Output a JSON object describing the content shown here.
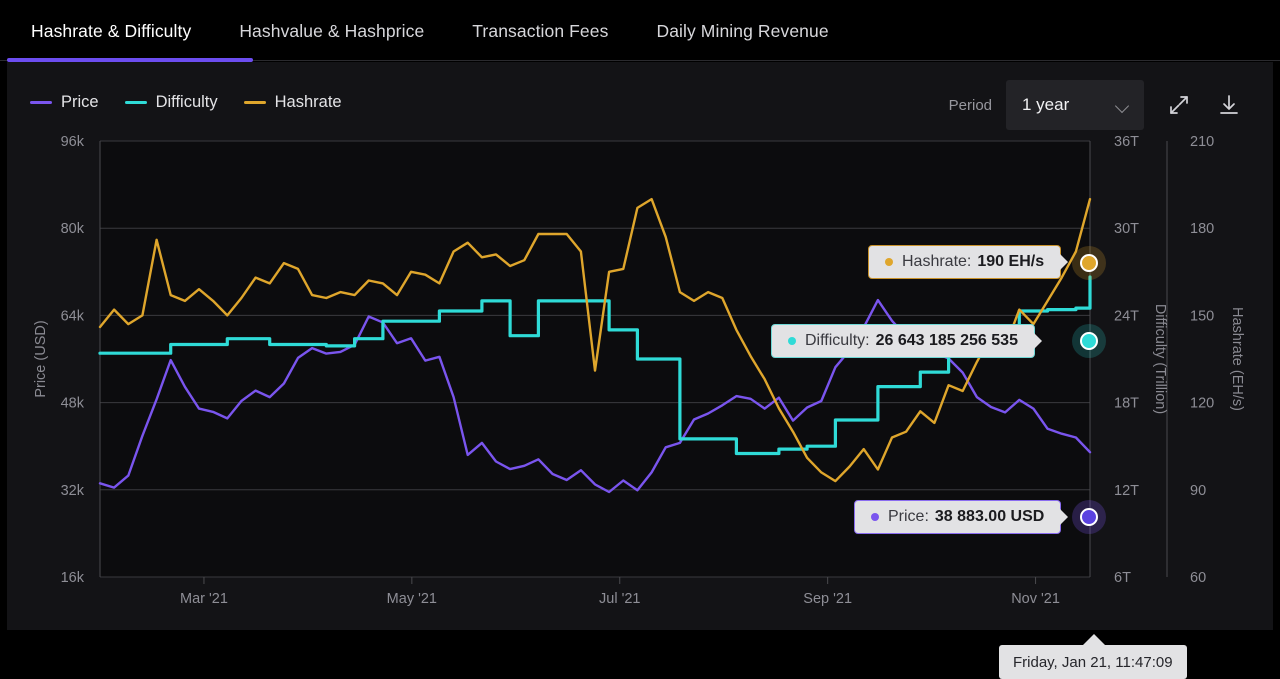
{
  "tabs": [
    {
      "label": "Hashrate & Difficulty",
      "active": true
    },
    {
      "label": "Hashvalue & Hashprice",
      "active": false
    },
    {
      "label": "Transaction Fees",
      "active": false
    },
    {
      "label": "Daily Mining Revenue",
      "active": false
    }
  ],
  "toolbar": {
    "period_label": "Period",
    "period_value": "1 year",
    "chevron_icon": "chevron-down-icon",
    "expand_icon": "expand-fullscreen-icon",
    "download_icon": "download-icon"
  },
  "legend": [
    {
      "label": "Price",
      "color": "#7a55ee"
    },
    {
      "label": "Difficulty",
      "color": "#2fdbd7"
    },
    {
      "label": "Hashrate",
      "color": "#dfa62c"
    }
  ],
  "tooltips": {
    "hashrate": {
      "name": "Hashrate:",
      "value": "190 EH/s",
      "color": "#dfa62c",
      "border": "#c9922a"
    },
    "difficulty": {
      "name": "Difficulty:",
      "value": "26 643 185 256 535",
      "color": "#2fdbd7",
      "border": "#6fd8d6"
    },
    "price": {
      "name": "Price:",
      "value": "38 883.00 USD",
      "color": "#7a55ee",
      "border": "#8a6cf0"
    },
    "date": {
      "value": "Friday, Jan 21, 11:47:09"
    }
  },
  "chart_data": {
    "type": "line",
    "title": "Hashrate & Difficulty",
    "xlabel": "",
    "grid": true,
    "legend_position": "top-left",
    "x_tick_labels": [
      "Mar '21",
      "May '21",
      "Jul '21",
      "Sep '21",
      "Nov '21"
    ],
    "x_tick_positions": [
      0.105,
      0.315,
      0.525,
      0.735,
      0.945
    ],
    "axes": [
      {
        "id": "price",
        "title": "Price (USD)",
        "side": "left",
        "ticks": [
          "96k",
          "80k",
          "64k",
          "48k",
          "32k",
          "16k"
        ],
        "tick_values": [
          96000,
          80000,
          64000,
          48000,
          32000,
          16000
        ],
        "ylim": [
          16000,
          96000
        ]
      },
      {
        "id": "difficulty",
        "title": "Difficulty (Trillion)",
        "side": "right",
        "ticks": [
          "36T",
          "30T",
          "24T",
          "18T",
          "12T",
          "6T"
        ],
        "tick_values": [
          36,
          30,
          24,
          18,
          12,
          6
        ],
        "ylim": [
          6,
          36
        ]
      },
      {
        "id": "hashrate",
        "title": "Hashrate (EH/s)",
        "side": "right",
        "ticks": [
          "210",
          "180",
          "150",
          "120",
          "90",
          "60"
        ],
        "tick_values": [
          210,
          180,
          150,
          120,
          90,
          60
        ],
        "ylim": [
          60,
          210
        ]
      }
    ],
    "series": [
      {
        "name": "Price",
        "color": "#7a55ee",
        "axis": "price",
        "unit": "USD",
        "last_value": 38883,
        "values": [
          33200,
          32400,
          34600,
          41900,
          48600,
          55800,
          50900,
          46900,
          46300,
          45100,
          48300,
          50200,
          49000,
          51500,
          56200,
          58000,
          57000,
          57300,
          58600,
          63800,
          62700,
          58900,
          59800,
          55700,
          56400,
          49000,
          38400,
          40600,
          37200,
          35800,
          36400,
          37600,
          34900,
          33800,
          35600,
          33000,
          31600,
          33700,
          31900,
          35200,
          39800,
          40600,
          44900,
          46000,
          47500,
          49200,
          48700,
          46900,
          48900,
          44700,
          47100,
          48300,
          54500,
          57600,
          61800,
          66800,
          63000,
          60200,
          58800,
          57200,
          56100,
          53500,
          49000,
          47200,
          46200,
          48500,
          46900,
          43200,
          42300,
          41600,
          38900
        ]
      },
      {
        "name": "Difficulty",
        "color": "#2fdbd7",
        "axis": "difficulty",
        "unit": "Trillion",
        "last_value": 26.64,
        "last_value_raw": "26 643 185 256 535",
        "values": [
          21.4,
          21.4,
          21.4,
          21.4,
          21.4,
          22.0,
          22.0,
          22.0,
          22.0,
          22.4,
          22.4,
          22.4,
          22.0,
          22.0,
          22.0,
          22.0,
          21.9,
          21.9,
          22.4,
          22.4,
          23.6,
          23.6,
          23.6,
          23.6,
          24.3,
          24.3,
          24.3,
          25.0,
          25.0,
          22.6,
          22.6,
          25.0,
          25.0,
          25.0,
          25.0,
          25.0,
          23.0,
          23.0,
          21.0,
          21.0,
          21.0,
          15.5,
          15.5,
          15.5,
          15.5,
          14.5,
          14.5,
          14.5,
          14.8,
          14.8,
          15.0,
          15.0,
          16.8,
          16.8,
          16.8,
          19.1,
          19.1,
          19.1,
          20.1,
          20.1,
          21.7,
          21.7,
          21.7,
          22.3,
          22.3,
          24.3,
          24.3,
          24.4,
          24.4,
          24.5,
          26.64
        ]
      },
      {
        "name": "Hashrate",
        "color": "#dfa62c",
        "axis": "hashrate",
        "unit": "EH/s",
        "last_value": 190,
        "values": [
          146,
          152,
          147,
          150,
          176,
          157,
          155,
          159,
          155,
          150,
          156,
          163,
          161,
          168,
          166,
          157,
          156,
          158,
          157,
          162,
          161,
          157,
          165,
          164,
          161,
          172,
          175,
          170,
          171,
          167,
          169,
          178,
          178,
          178,
          172,
          131,
          165,
          166,
          187,
          190,
          177,
          158,
          155,
          158,
          156,
          145,
          136,
          128,
          118,
          110,
          101,
          96,
          93,
          98,
          104,
          97,
          108,
          110,
          117,
          113,
          126,
          124,
          134,
          143,
          139,
          152,
          147,
          155,
          163,
          172,
          190
        ]
      }
    ]
  }
}
